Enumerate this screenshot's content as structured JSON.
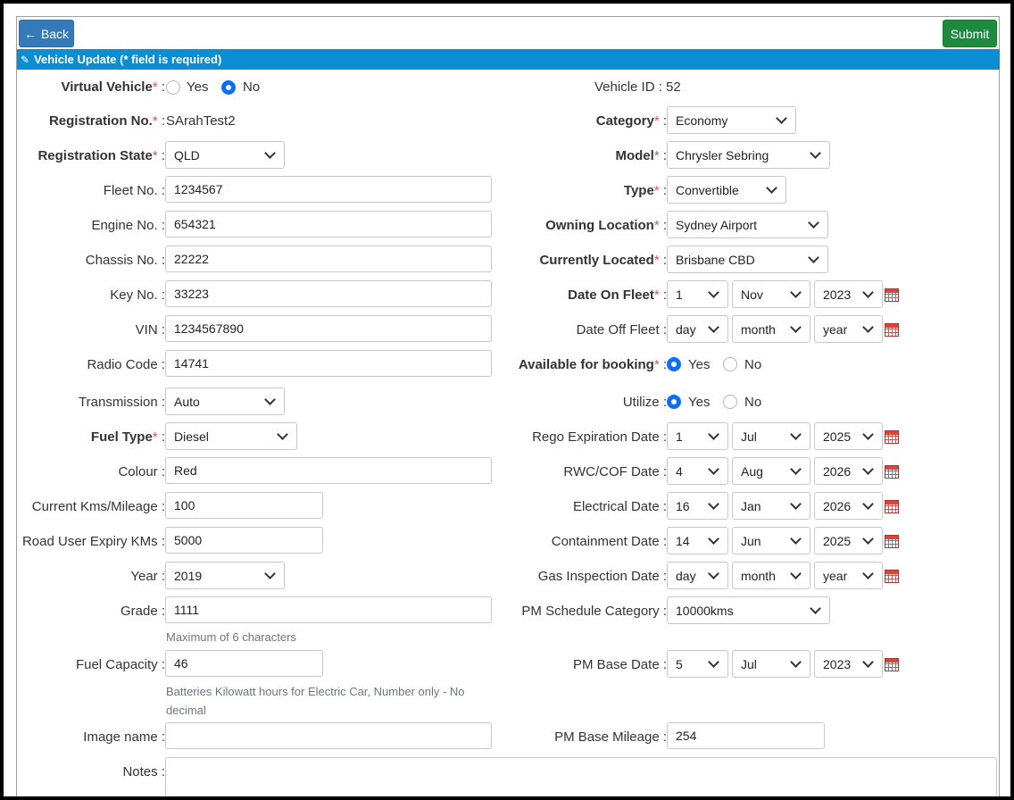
{
  "header": {
    "back_label": "Back",
    "submit_label": "Submit",
    "section_title": "Vehicle Update (* field is required)"
  },
  "left": {
    "virtual_vehicle": {
      "label": "Virtual Vehicle",
      "options": [
        "Yes",
        "No"
      ],
      "selected": "No"
    },
    "registration_no": {
      "label": "Registration No.",
      "value": "SArahTest2"
    },
    "registration_state": {
      "label": "Registration State",
      "value": "QLD"
    },
    "fleet_no": {
      "label": "Fleet No. :",
      "value": "1234567"
    },
    "engine_no": {
      "label": "Engine No. :",
      "value": "654321"
    },
    "chassis_no": {
      "label": "Chassis No. :",
      "value": "22222"
    },
    "key_no": {
      "label": "Key No. :",
      "value": "33223"
    },
    "vin": {
      "label": "VIN :",
      "value": "1234567890"
    },
    "radio_code": {
      "label": "Radio Code :",
      "value": "14741"
    },
    "transmission": {
      "label": "Transmission :",
      "value": "Auto"
    },
    "fuel_type": {
      "label": "Fuel Type",
      "value": "Diesel"
    },
    "colour": {
      "label": "Colour :",
      "value": "Red"
    },
    "current_kms": {
      "label": "Current Kms/Mileage :",
      "value": "100"
    },
    "road_user_expiry": {
      "label": "Road User Expiry KMs :",
      "value": "5000"
    },
    "year": {
      "label": "Year :",
      "value": "2019"
    },
    "grade": {
      "label": "Grade :",
      "value": "1111",
      "help": "Maximum of 6 characters"
    },
    "fuel_capacity": {
      "label": "Fuel Capacity :",
      "value": "46",
      "help": "Batteries Kilowatt hours for Electric Car, Number only - No decimal"
    },
    "image_name": {
      "label": "Image name :",
      "value": ""
    },
    "notes": {
      "label": "Notes :",
      "value": ""
    }
  },
  "right": {
    "vehicle_id": "Vehicle ID : 52",
    "category": {
      "label": "Category",
      "value": "Economy"
    },
    "model": {
      "label": "Model",
      "value": "Chrysler Sebring"
    },
    "type": {
      "label": "Type",
      "value": "Convertible"
    },
    "owning_location": {
      "label": "Owning Location",
      "value": "Sydney Airport"
    },
    "currently_located": {
      "label": "Currently Located",
      "value": "Brisbane CBD"
    },
    "date_on_fleet": {
      "label": "Date On Fleet",
      "day": "1",
      "month": "Nov",
      "year": "2023"
    },
    "date_off_fleet": {
      "label": "Date Off Fleet :",
      "day": "day",
      "month": "month",
      "year": "year"
    },
    "available_for_booking": {
      "label": "Available for booking",
      "options": [
        "Yes",
        "No"
      ],
      "selected": "Yes"
    },
    "utilize": {
      "label": "Utilize :",
      "options": [
        "Yes",
        "No"
      ],
      "selected": "Yes"
    },
    "rego_expiration": {
      "label": "Rego Expiration Date :",
      "day": "1",
      "month": "Jul",
      "year": "2025"
    },
    "rwc_cof": {
      "label": "RWC/COF Date :",
      "day": "4",
      "month": "Aug",
      "year": "2026"
    },
    "electrical": {
      "label": "Electrical Date :",
      "day": "16",
      "month": "Jan",
      "year": "2026"
    },
    "containment": {
      "label": "Containment Date :",
      "day": "14",
      "month": "Jun",
      "year": "2025"
    },
    "gas_inspection": {
      "label": "Gas Inspection Date :",
      "day": "day",
      "month": "month",
      "year": "year"
    },
    "pm_schedule_category": {
      "label": "PM Schedule Category :",
      "value": "10000kms"
    },
    "pm_base_date": {
      "label": "PM Base Date :",
      "day": "5",
      "month": "Jul",
      "year": "2023"
    },
    "pm_base_mileage": {
      "label": "PM Base Mileage :",
      "value": "254"
    }
  },
  "icons": {
    "back": "arrow-left-icon",
    "edit": "pencil-icon",
    "calendar": "calendar-icon",
    "dropdown": "chevron-down-icon"
  },
  "colors": {
    "primary": "#337ab7",
    "success": "#1e8a3e",
    "section_bar": "#0b8dd4",
    "required": "#d9534f",
    "radio_checked": "#0d6efd"
  }
}
